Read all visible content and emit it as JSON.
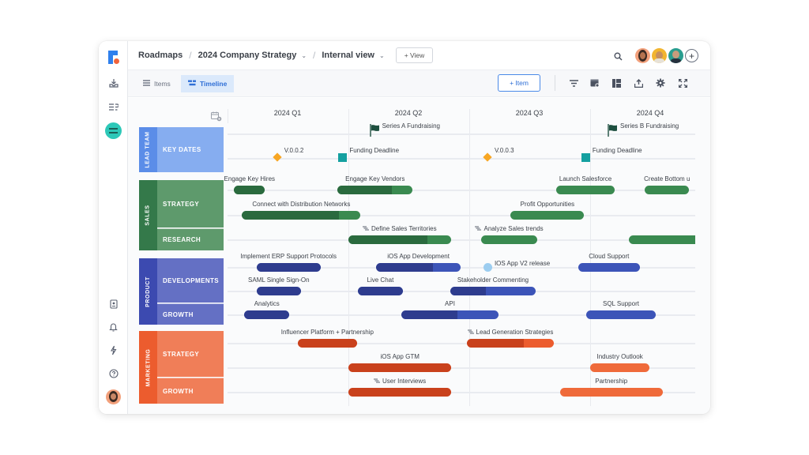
{
  "breadcrumb": {
    "root": "Roadmaps",
    "roadmap": "2024 Company Strategy",
    "view": "Internal view",
    "add_view": "+ View"
  },
  "tabs": [
    {
      "label": "Items",
      "icon": "list-icon",
      "active": false
    },
    {
      "label": "Timeline",
      "icon": "timeline-icon",
      "active": true
    }
  ],
  "toolbar": {
    "add_item": "+ Item",
    "icons": [
      "filter-icon",
      "card-settings-icon",
      "layout-icon",
      "export-icon",
      "gear-icon",
      "fullscreen-icon"
    ]
  },
  "header_icons": [
    "search-icon",
    "add-collaborator-icon"
  ],
  "collaborators": [
    {
      "color": "#f2a07b"
    },
    {
      "color": "#f2b530"
    },
    {
      "color": "#2a9d8f"
    }
  ],
  "rail_icons": {
    "top": [
      "logo",
      "inbox-icon",
      "list-redo-icon",
      "roadmap-icon"
    ],
    "bottom": [
      "contacts-icon",
      "bell-icon",
      "lightning-icon",
      "help-icon",
      "user-avatar"
    ]
  },
  "quarters": [
    "2024 Q1",
    "2024 Q2",
    "2024 Q3",
    "2024 Q4"
  ],
  "groups": [
    {
      "name": "LEAD TEAM",
      "color": "#5b8de8",
      "lane_color": "#86adf0",
      "lanes": [
        "KEY DATES"
      ]
    },
    {
      "name": "SALES",
      "color": "#34794a",
      "lane_color": "#5e9a6c",
      "lanes": [
        "STRATEGY",
        "RESEARCH"
      ]
    },
    {
      "name": "PRODUCT",
      "color": "#3c4ab0",
      "lane_color": "#6470c4",
      "lanes": [
        "DEVELOPMENTS",
        "GROWTH"
      ]
    },
    {
      "name": "MARKETING",
      "color": "#ec5c2e",
      "lane_color": "#f07e58",
      "lanes": [
        "STRATEGY",
        "GROWTH"
      ]
    }
  ],
  "milestones": [
    {
      "label": "Series A Fundraising",
      "type": "flag",
      "quarter_pos": 1.2,
      "color": "#1d4f3f"
    },
    {
      "label": "Series B Fundraising",
      "type": "flag",
      "quarter_pos": 3.17,
      "color": "#1d4f3f"
    },
    {
      "label": "V.0.0.2",
      "type": "diamond",
      "quarter_pos": 0.41,
      "color": "#f7a623"
    },
    {
      "label": "Funding Deadline",
      "type": "square",
      "quarter_pos": 0.95,
      "color": "#14a0a0"
    },
    {
      "label": "V.0.0.3",
      "type": "diamond",
      "quarter_pos": 2.15,
      "color": "#f7a623"
    },
    {
      "label": "Funding Deadline",
      "type": "square",
      "quarter_pos": 2.96,
      "color": "#14a0a0"
    },
    {
      "label": "IOS App V2 release",
      "type": "dot",
      "quarter_pos": 2.15,
      "color": "#9ccdf0"
    }
  ],
  "items": [
    {
      "label": "Engage Key Hires",
      "row": 0,
      "start": 0.05,
      "end": 0.31,
      "progress": 1.0,
      "color": "sales"
    },
    {
      "label": "Engage Key Vendors",
      "row": 0,
      "start": 0.91,
      "end": 1.53,
      "progress": 0.73,
      "color": "sales"
    },
    {
      "label": "Launch Salesforce",
      "row": 0,
      "start": 2.72,
      "end": 3.2,
      "progress": 0,
      "color": "sales"
    },
    {
      "label": "Create Bottom u",
      "row": 0,
      "start": 3.45,
      "end": 3.82,
      "progress": 0,
      "color": "sales"
    },
    {
      "label": "Connect with Distribution Networks",
      "row": 1,
      "start": 0.12,
      "end": 1.1,
      "progress": 0.82,
      "color": "sales"
    },
    {
      "label": "Profit Opportunities",
      "row": 1,
      "start": 2.34,
      "end": 2.95,
      "progress": 0,
      "color": "sales"
    },
    {
      "label": "Define Sales Territories",
      "row": 2,
      "start": 1.0,
      "end": 1.85,
      "progress": 0.77,
      "color": "sales",
      "icon": true
    },
    {
      "label": "Analyze Sales trends",
      "row": 2,
      "start": 2.1,
      "end": 2.56,
      "progress": 0,
      "color": "sales",
      "icon": true
    },
    {
      "label": "",
      "row": 2,
      "start": 3.32,
      "end": 3.9,
      "progress": 0,
      "color": "sales"
    },
    {
      "label": "Implement ERP Support Protocols",
      "row": 3,
      "start": 0.24,
      "end": 0.77,
      "progress": 1.0,
      "color": "product"
    },
    {
      "label": "iOS App Development",
      "row": 3,
      "start": 1.23,
      "end": 1.93,
      "progress": 0.67,
      "color": "product"
    },
    {
      "label": "Cloud Support",
      "row": 3,
      "start": 2.9,
      "end": 3.41,
      "progress": 0,
      "color": "product"
    },
    {
      "label": "SAML Single Sign-On",
      "row": 4,
      "start": 0.24,
      "end": 0.61,
      "progress": 1.0,
      "color": "product"
    },
    {
      "label": "Live Chat",
      "row": 4,
      "start": 1.08,
      "end": 1.45,
      "progress": 1.0,
      "color": "product"
    },
    {
      "label": "Stakeholder Commenting",
      "row": 4,
      "start": 1.84,
      "end": 2.55,
      "progress": 0.42,
      "color": "product"
    },
    {
      "label": "Analytics",
      "row": 5,
      "start": 0.14,
      "end": 0.51,
      "progress": 1.0,
      "color": "product"
    },
    {
      "label": "API",
      "row": 5,
      "start": 1.44,
      "end": 2.24,
      "progress": 0.58,
      "color": "product"
    },
    {
      "label": "SQL Support",
      "row": 5,
      "start": 2.97,
      "end": 3.54,
      "progress": 0,
      "color": "product"
    },
    {
      "label": "Influencer Platform + Partnership",
      "row": 6,
      "start": 0.58,
      "end": 1.07,
      "progress": 1.0,
      "color": "marketing"
    },
    {
      "label": "Lead Generation Strategies",
      "row": 6,
      "start": 1.98,
      "end": 2.7,
      "progress": 0.65,
      "color": "marketing",
      "icon": true
    },
    {
      "label": "iOS App GTM",
      "row": 7,
      "start": 1.0,
      "end": 1.85,
      "progress": 1.0,
      "color": "marketing"
    },
    {
      "label": "Industry Outlook",
      "row": 7,
      "start": 3.0,
      "end": 3.49,
      "progress": 0,
      "color": "marketing-light"
    },
    {
      "label": "User Interviews",
      "row": 8,
      "start": 1.0,
      "end": 1.85,
      "progress": 1.0,
      "color": "marketing",
      "icon": true
    },
    {
      "label": "Partnership",
      "row": 8,
      "start": 2.75,
      "end": 3.6,
      "progress": 0,
      "color": "marketing-light"
    }
  ],
  "palette": {
    "sales": {
      "base": "#3a8a50",
      "dark": "#2a6a3e"
    },
    "product": {
      "base": "#3c54b8",
      "dark": "#2e3c8e"
    },
    "marketing": {
      "base": "#ec5c2e",
      "dark": "#c9411c"
    },
    "marketing-light": {
      "base": "#ef6a3a",
      "dark": "#ef6a3a"
    }
  }
}
